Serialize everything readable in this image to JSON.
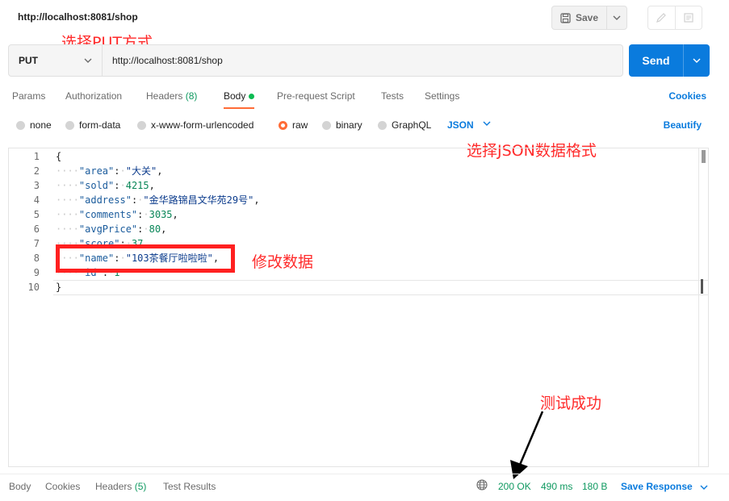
{
  "request": {
    "title": "http://localhost:8081/shop",
    "method": "PUT",
    "url": "http://localhost:8081/shop"
  },
  "toolbar": {
    "save_label": "Save",
    "send_label": "Send"
  },
  "tabs": [
    {
      "label": "Params"
    },
    {
      "label": "Authorization"
    },
    {
      "label": "Headers",
      "count": "(8)"
    },
    {
      "label": "Body"
    },
    {
      "label": "Pre-request Script"
    },
    {
      "label": "Tests"
    },
    {
      "label": "Settings"
    }
  ],
  "cookies_label": "Cookies",
  "body_types": [
    "none",
    "form-data",
    "x-www-form-urlencoded",
    "raw",
    "binary",
    "GraphQL"
  ],
  "body_format": "JSON",
  "beautify_label": "Beautify",
  "editor_lines": {
    "l1": "{",
    "l2_key": "\"area\"",
    "l2_val": "\"大关\"",
    "l3_key": "\"sold\"",
    "l3_val": "4215",
    "l4_key": "\"address\"",
    "l4_val": "\"金华路锦昌文华苑29号\"",
    "l5_key": "\"comments\"",
    "l5_val": "3035",
    "l6_key": "\"avgPrice\"",
    "l6_val": "80",
    "l7_key": "\"score\"",
    "l7_val": "37",
    "l8_key": "\"name\"",
    "l8_val": "\"103茶餐厅啦啦啦\"",
    "l9_key": "\"id\"",
    "l9_val": "1",
    "l10": "}"
  },
  "annotations": {
    "select_put": "选择PUT方式",
    "select_json": "选择JSON数据格式",
    "modify_data": "修改数据",
    "test_success": "测试成功"
  },
  "response_bar": {
    "tabs": [
      {
        "label": "Body"
      },
      {
        "label": "Cookies"
      },
      {
        "label": "Headers",
        "count": "(5)"
      },
      {
        "label": "Test Results"
      }
    ],
    "status": "200 OK",
    "time": "490 ms",
    "size": "180 B",
    "save_response": "Save Response"
  },
  "colors": {
    "accent_blue": "#0a7bdd",
    "active_orange": "#ff6c37",
    "status_green": "#0f9960",
    "annotation_red": "#ff2a2a"
  }
}
